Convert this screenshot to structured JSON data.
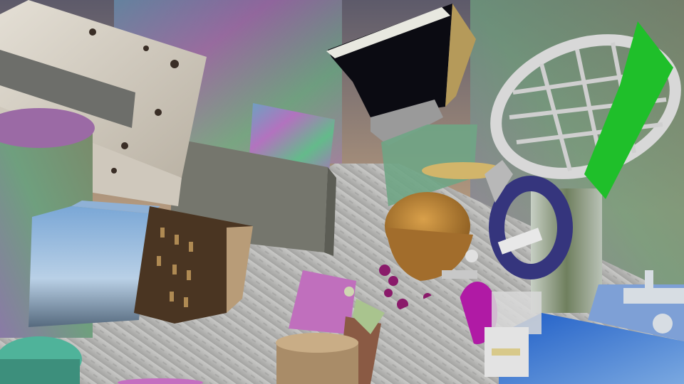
{
  "scene": {
    "objects": [
      {
        "name": "sky-backdrop",
        "color": "#8a7a7a"
      },
      {
        "name": "diamond-plate-floor",
        "color": "#b9b9b9"
      },
      {
        "name": "birch-texture-box",
        "color": "#d8d2c6"
      },
      {
        "name": "iridescent-cylinder",
        "color": "#5e8a4e"
      },
      {
        "name": "mountain-photo-cube",
        "color": "#5b8ec0"
      },
      {
        "name": "building-photo-cube",
        "color": "#5a3e26"
      },
      {
        "name": "granite-slab",
        "color": "#74746c"
      },
      {
        "name": "pink-iridescent-cube",
        "color": "#c46fc0"
      },
      {
        "name": "teal-cylinder",
        "color": "#4fb39a"
      },
      {
        "name": "wood-log-cylinder",
        "color": "#b89a74"
      },
      {
        "name": "brown-cube",
        "color": "#8a5a44"
      },
      {
        "name": "black-white-angled-panel",
        "color": "#0b0b12"
      },
      {
        "name": "wicker-basket",
        "color": "#c28a3a"
      },
      {
        "name": "white-lattice-disc",
        "color": "#d7d7d7"
      },
      {
        "name": "green-fin-plane",
        "color": "#1fbf2a"
      },
      {
        "name": "purple-ring-torus",
        "color": "#3c3c84"
      },
      {
        "name": "toy-robot-figure",
        "color": "#b01aa5"
      },
      {
        "name": "flower-cluster",
        "color": "#8a1a6a"
      },
      {
        "name": "blue-sky-block",
        "color": "#2f66c4"
      },
      {
        "name": "forest-photo-cylinder",
        "color": "#8d9a86"
      }
    ]
  }
}
